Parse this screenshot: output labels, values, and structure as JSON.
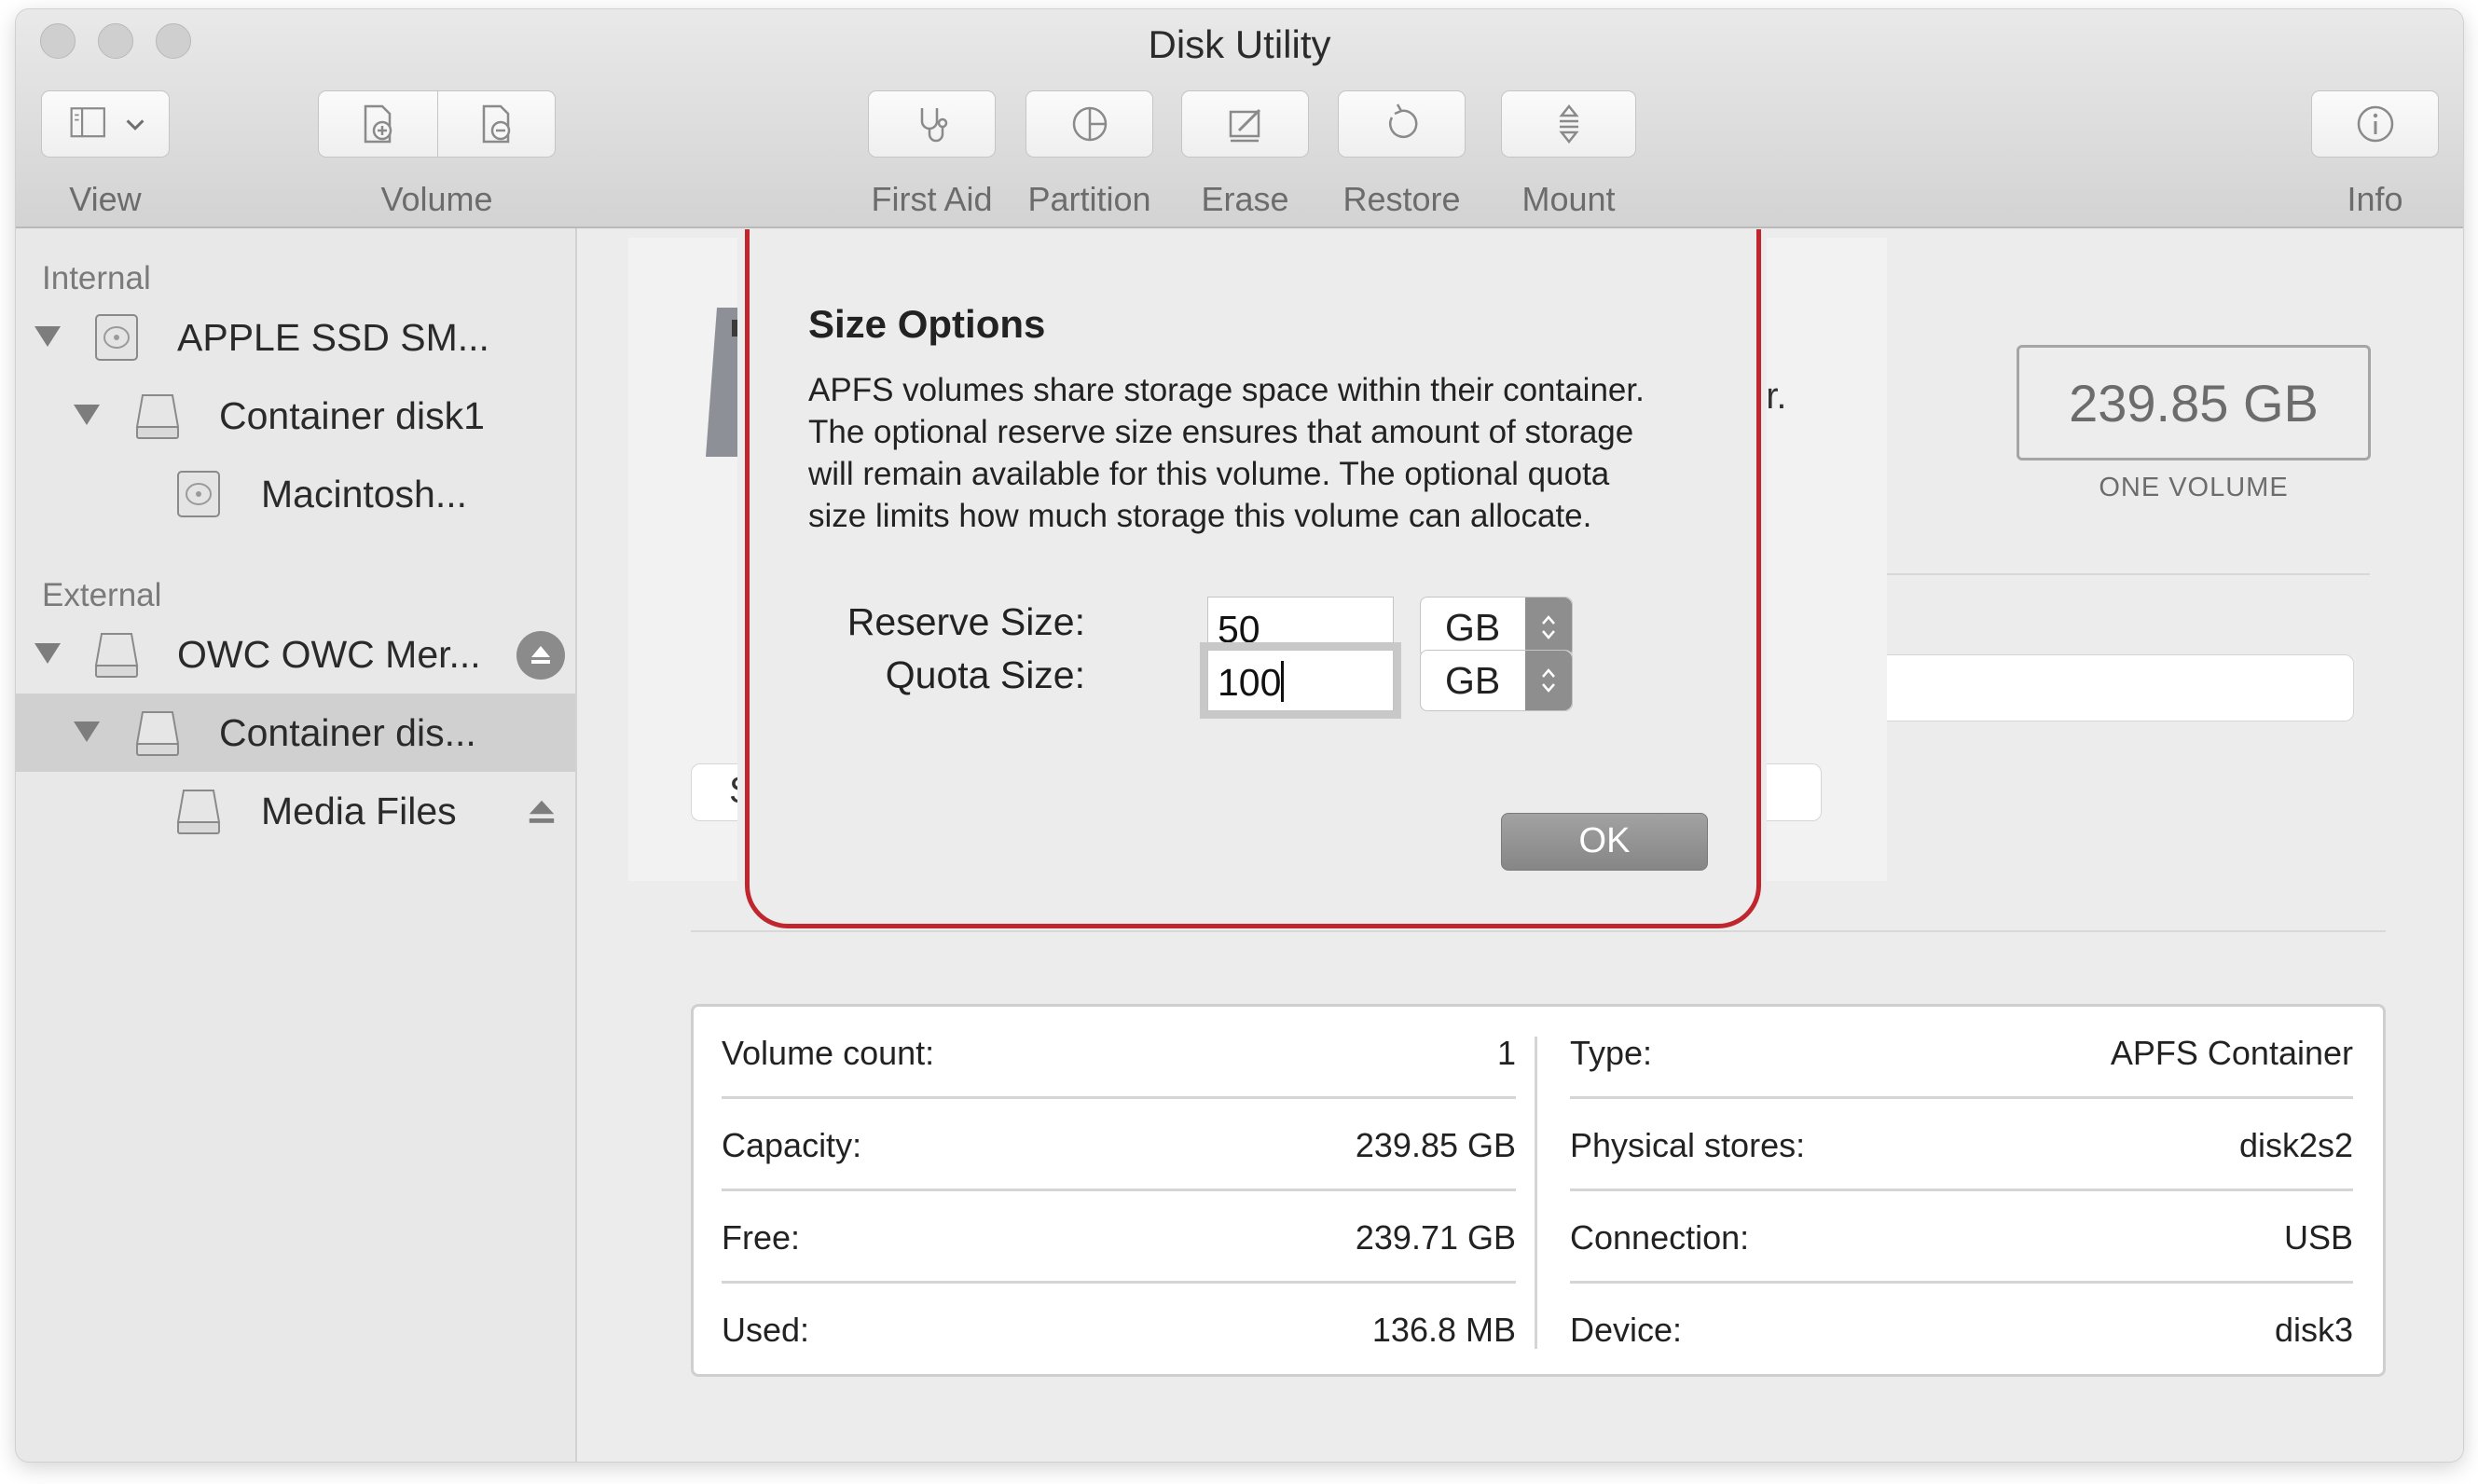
{
  "window": {
    "title": "Disk Utility"
  },
  "toolbar": {
    "view_label": "View",
    "volume_label": "Volume",
    "first_aid_label": "First Aid",
    "partition_label": "Partition",
    "erase_label": "Erase",
    "restore_label": "Restore",
    "mount_label": "Mount",
    "info_label": "Info"
  },
  "sidebar": {
    "internal_header": "Internal",
    "external_header": "External",
    "internal_items": [
      {
        "label": "APPLE SSD SM...",
        "icon": "internal-disk-icon"
      },
      {
        "label": "Container disk1",
        "icon": "container-disk-icon"
      },
      {
        "label": "Macintosh...",
        "icon": "volume-disk-icon"
      }
    ],
    "external_items": [
      {
        "label": "OWC OWC Mer...",
        "icon": "external-disk-icon"
      },
      {
        "label": "Container dis...",
        "icon": "container-disk-icon"
      },
      {
        "label": "Media Files",
        "icon": "volume-disk-icon"
      }
    ]
  },
  "main": {
    "capacity_value": "239.85 GB",
    "capacity_sub": "ONE VOLUME",
    "obscured_text_fragment": "er.",
    "obscured_button_fragment": "S"
  },
  "details": {
    "rows": [
      {
        "left_label": "Volume count:",
        "left_value": "1",
        "right_label": "Type:",
        "right_value": "APFS Container"
      },
      {
        "left_label": "Capacity:",
        "left_value": "239.85 GB",
        "right_label": "Physical stores:",
        "right_value": "disk2s2"
      },
      {
        "left_label": "Free:",
        "left_value": "239.71 GB",
        "right_label": "Connection:",
        "right_value": "USB"
      },
      {
        "left_label": "Used:",
        "left_value": "136.8 MB",
        "right_label": "Device:",
        "right_value": "disk3"
      }
    ]
  },
  "dialog": {
    "title": "Size Options",
    "body_lines": [
      "APFS volumes share storage space within their container.",
      "The optional reserve size ensures that amount of storage",
      "will remain available for this volume. The optional quota",
      "size limits how much storage this volume can allocate."
    ],
    "reserve_label": "Reserve Size:",
    "reserve_value": "50",
    "reserve_unit": "GB",
    "quota_label": "Quota Size:",
    "quota_value": "100",
    "quota_unit": "GB",
    "ok_label": "OK",
    "highlight_color": "#c0262e"
  }
}
